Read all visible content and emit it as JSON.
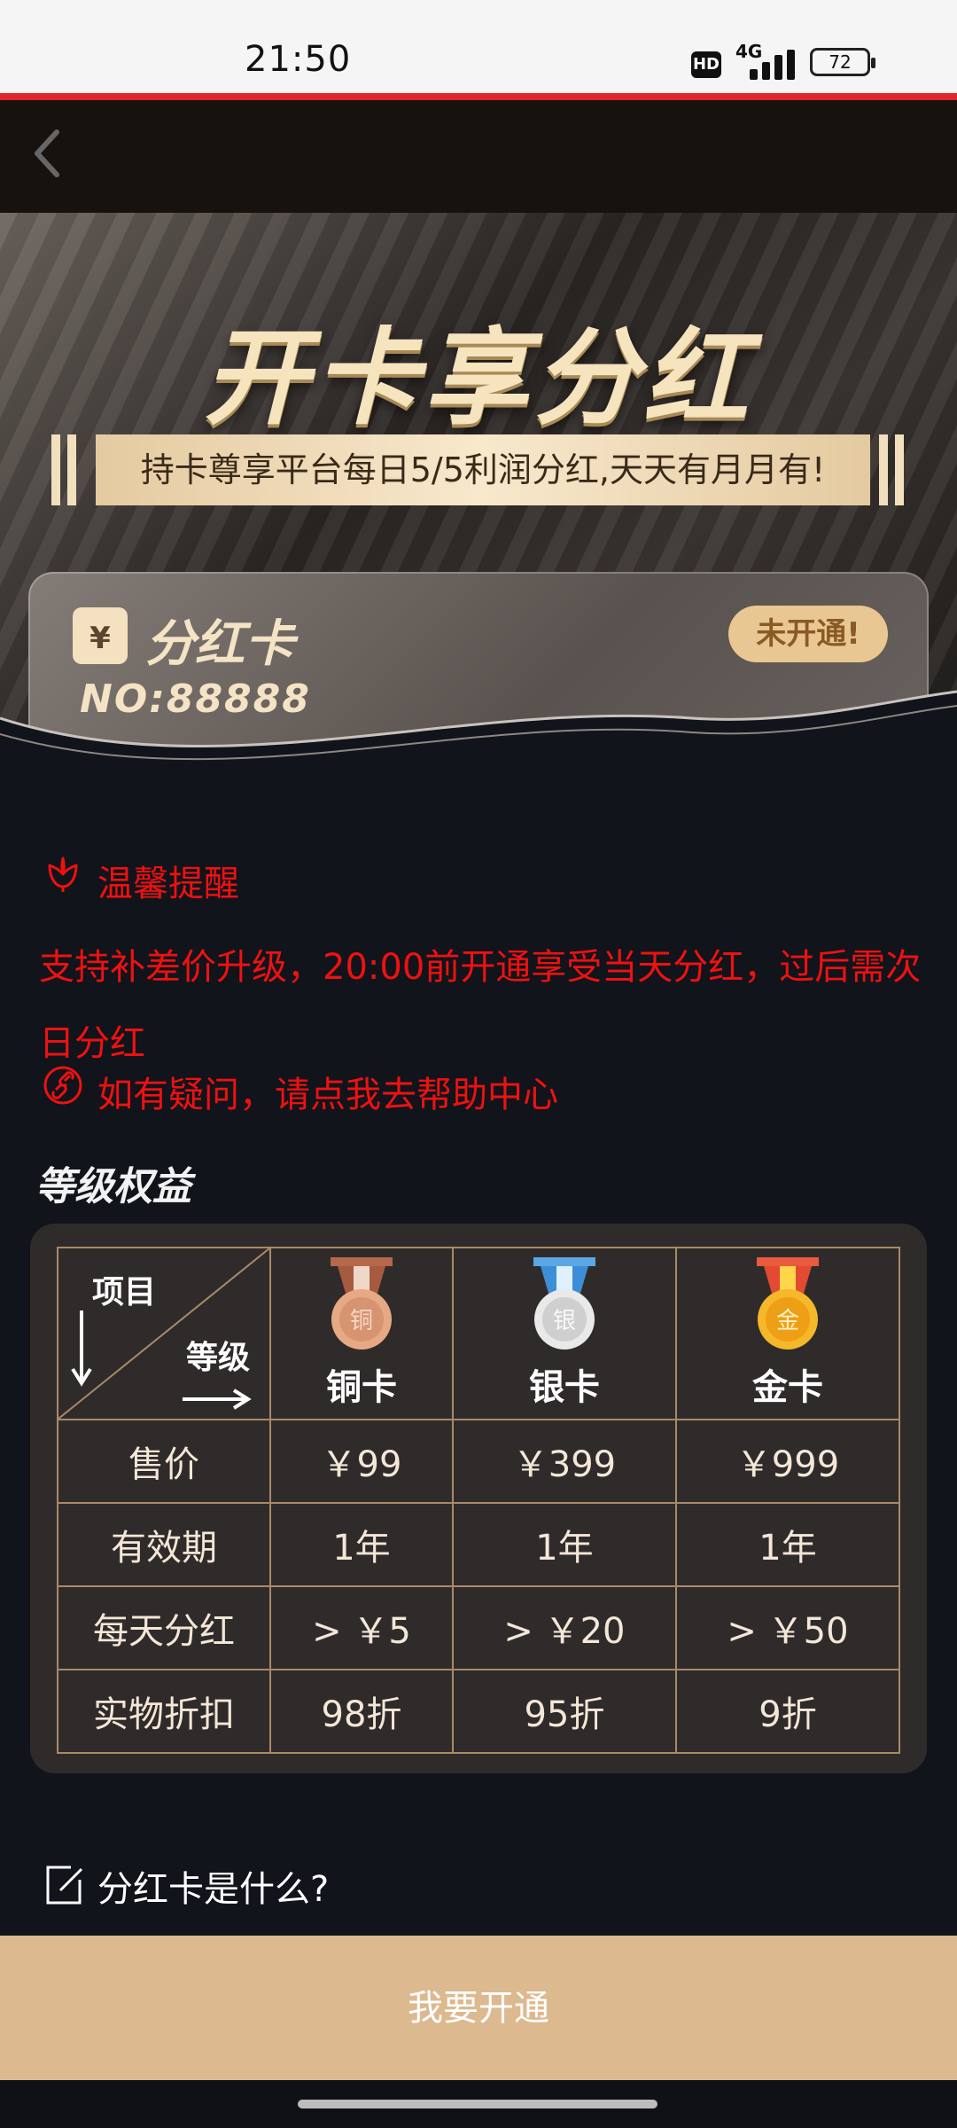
{
  "status_bar": {
    "time": "21:50",
    "hd": "HD",
    "network": "4G",
    "battery": "72"
  },
  "header": {
    "back_icon": "chevron-left-icon"
  },
  "banner": {
    "title": "开卡享分红",
    "ribbon_text": "持卡尊享平台每日5/5利润分红,天天有月月有!",
    "card": {
      "icon_text": "¥",
      "title": "分红卡",
      "number": "NO:88888",
      "status": "未开通!"
    }
  },
  "notice": {
    "title": "温馨提醒",
    "body": "支持补差价升级，20:00前开通享受当天分红，过后需次日分红",
    "help_link": "如有疑问，请点我去帮助中心"
  },
  "levels": {
    "section_title": "等级权益",
    "corner_item": "项目",
    "corner_level": "等级",
    "columns": [
      {
        "name": "铜卡",
        "medal_char": "铜",
        "color": "#d49a73"
      },
      {
        "name": "银卡",
        "medal_char": "银",
        "color": "#d9d9d9"
      },
      {
        "name": "金卡",
        "medal_char": "金",
        "color": "#f2b526"
      }
    ],
    "rows": [
      {
        "label": "售价",
        "values": [
          "￥99",
          "￥399",
          "￥999"
        ]
      },
      {
        "label": "有效期",
        "values": [
          "1年",
          "1年",
          "1年"
        ]
      },
      {
        "label": "每天分红",
        "values": [
          "> ￥5",
          "> ￥20",
          "> ￥50"
        ]
      },
      {
        "label": "实物折扣",
        "values": [
          "98折",
          "95折",
          "9折"
        ]
      }
    ]
  },
  "faq": {
    "question": "分红卡是什么?"
  },
  "bottom": {
    "cta": "我要开通"
  },
  "colors": {
    "accent_red": "#e11111",
    "gold": "#ddb98f",
    "panel": "#302b2b"
  }
}
